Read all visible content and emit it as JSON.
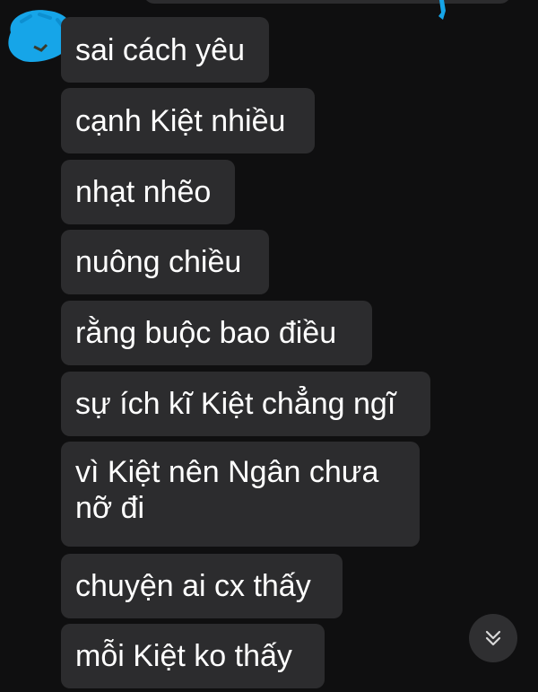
{
  "messages": [
    {
      "text": "sai cách yêu"
    },
    {
      "text": "cạnh Kiệt nhiều"
    },
    {
      "text": "nhạt nhẽo"
    },
    {
      "text": "nuông chiều"
    },
    {
      "text": "rằng buộc bao điều"
    },
    {
      "text": "sự ích kĩ Kiệt chẳng ngĩ"
    },
    {
      "text": "vì Kiệt nên Ngân chưa\nnỡ đi"
    },
    {
      "text": "chuyện ai cx thấy"
    },
    {
      "text": "mỗi Kiệt ko thấy"
    }
  ],
  "colors": {
    "background": "#0f0f10",
    "bubble": "#2c2c2e",
    "text": "#ffffff",
    "scribble": "#16a5e8"
  },
  "icons": {
    "scroll_down": "double-chevron-down-icon"
  }
}
